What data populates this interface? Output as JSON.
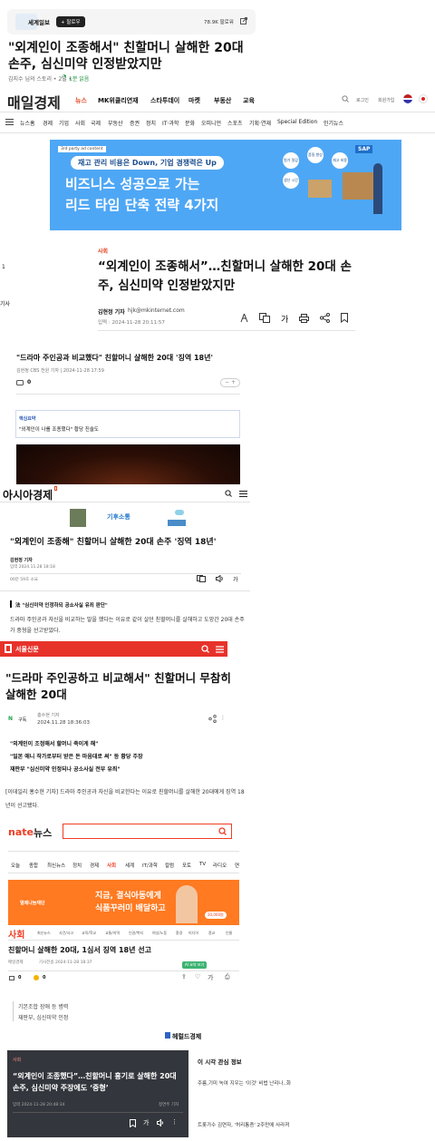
{
  "s1": {
    "brand": "세계일보",
    "follow": "+ 팔로우",
    "count": "78.9K 팔로워",
    "headline": "\"외계인이 조종해서\" 친할머니 살해한 20대 손주, 심신미약 인정받았지만",
    "meta": "김지수 님의 스토리 • 2일 • ",
    "read": "1분 읽음"
  },
  "maeil": {
    "logo": "매일경제",
    "nav": [
      "뉴스",
      "MK위클리연재",
      "스타투데이",
      "마켓",
      "부동산",
      "교육"
    ],
    "login": "로그인",
    "signup": "회원가입",
    "cats": [
      "뉴스홈",
      "경제",
      "기업",
      "사회",
      "국제",
      "부동산",
      "증권",
      "정치",
      "IT·과학",
      "문화",
      "오피니언",
      "스포츠",
      "기획·연재",
      "Special Edition",
      "인기뉴스"
    ],
    "ad": {
      "tag": "3rd party ad content",
      "sub": "재고 관리 비용은 Down, 기업 경쟁력은 Up",
      "l1": "비즈니스 성공으로 가는",
      "l2": "리드 타임 단축 전략 4가지",
      "brand": "SAP",
      "c1": "원가 절감",
      "c2": "품질 향상",
      "c3": "재고 비용",
      "c4": "생산 시간"
    },
    "section": "사회",
    "headline": "“외계인이 조종해서”…친할머니 살해한 20대 손주, 심신미약 인정받았지만",
    "reporter": "김현정 기자",
    "email": "hjk@mkinternet.com",
    "date": "입력 : 2024-11-28 20:11:57",
    "left1": "1",
    "left2": "기사"
  },
  "nocut": {
    "headline": "\"드라마 주인공과 비교했다\" 친할머니 살해한 20대 '징역 18년'",
    "byline": "김현정 CBS 전원 기자 | 2024-11-28 17:59",
    "comments": "0",
    "box_title": "핵심요약",
    "box_text": "\"외계인이 나를 조종했다\" 황당 진술도"
  },
  "asia": {
    "logo": "아시아경제",
    "ad_brand": "기후소통",
    "headline": "\"외계인이 조종해\" 친할머니 살해한 20대 손주 '징역 18년'",
    "reporter": "김현정 기자",
    "date": "입력 2024.11.28 18:18",
    "readtime": "00분 59초 소요",
    "quote": "法 \"심신미약 인정하되 공소사실 유죄 판단\"",
    "body": "드라마 주인공과 자신을 비교하는 말을 했다는 이유로 같이 살던 친할머니를 살해하고 도망간 20대 손주가 중형을 선고받았다."
  },
  "seoul": {
    "logo": "서울신문",
    "headline": "\"드라마 주인공하고 비교해서\" 친할머니 무참히 살해한 20대",
    "follow": "구독",
    "reporter": "홍수현 기자",
    "date": "2024.11.28 18:36:03",
    "bullets": [
      "\"외계인이 조정해서 할머니 죽이게 해\"",
      "\"일본 애니 작가로부터 받은 돈 마음대로 써\" 등 황당 주장",
      "재판부 \"심신미약 인정되나 공소사실 전부 유죄\""
    ],
    "body": "[이데일리 홍수현 기자] 드라마 주인공과 자신을 비교한다는 이유로 친할머니를 살해한 20대에게 징역 18년이 선고됐다."
  },
  "nate": {
    "logo": "nate",
    "logo_suffix": "뉴스",
    "tabs": [
      "오늘",
      "종합",
      "최신뉴스",
      "정치",
      "경제",
      "사회",
      "세계",
      "IT/과학",
      "칼럼",
      "포토",
      "TV",
      "라디오",
      "연"
    ],
    "ad": {
      "brand": "열매나눔재단",
      "l1": "지금, 결식아동에게",
      "l2": "식품꾸러미 배달하고",
      "badge": "20,000원"
    },
    "section": "사회",
    "subtabs": [
      "최신뉴스",
      "사건/사고",
      "교육/학교",
      "교통/지역",
      "인권/복지",
      "여성/노동",
      "환경",
      "미디어",
      "종교",
      "인물"
    ],
    "headline": "친할머니 살해한 20대, 1심서 징역 18년 선고",
    "source": "매일경제",
    "date": "기사전송 2024-11-28 18:37",
    "summary_btn": "AI 요약 보기",
    "c1": "0",
    "c2": "0",
    "summary": [
      "기본조합 장애 등 병력",
      "재판부, 심신미약 인정"
    ]
  },
  "herald": {
    "logo": "헤럴드경제",
    "section": "사회",
    "headline": "“외계인이 조종했다”…친할머니 흉기로 살해한 20대 손주, 심신미약 주장에도 ‘중형’",
    "date": "입력 2024-11-28 20:48:34",
    "reporter": "정연주 기자",
    "side_title": "이 시각 관심 정보",
    "side1": "주름,기미 녹여 지우는 '이것' 비법 난리나..화",
    "side2": "트롯가수 김연자, '허리통증' 2주만에 사라져"
  }
}
